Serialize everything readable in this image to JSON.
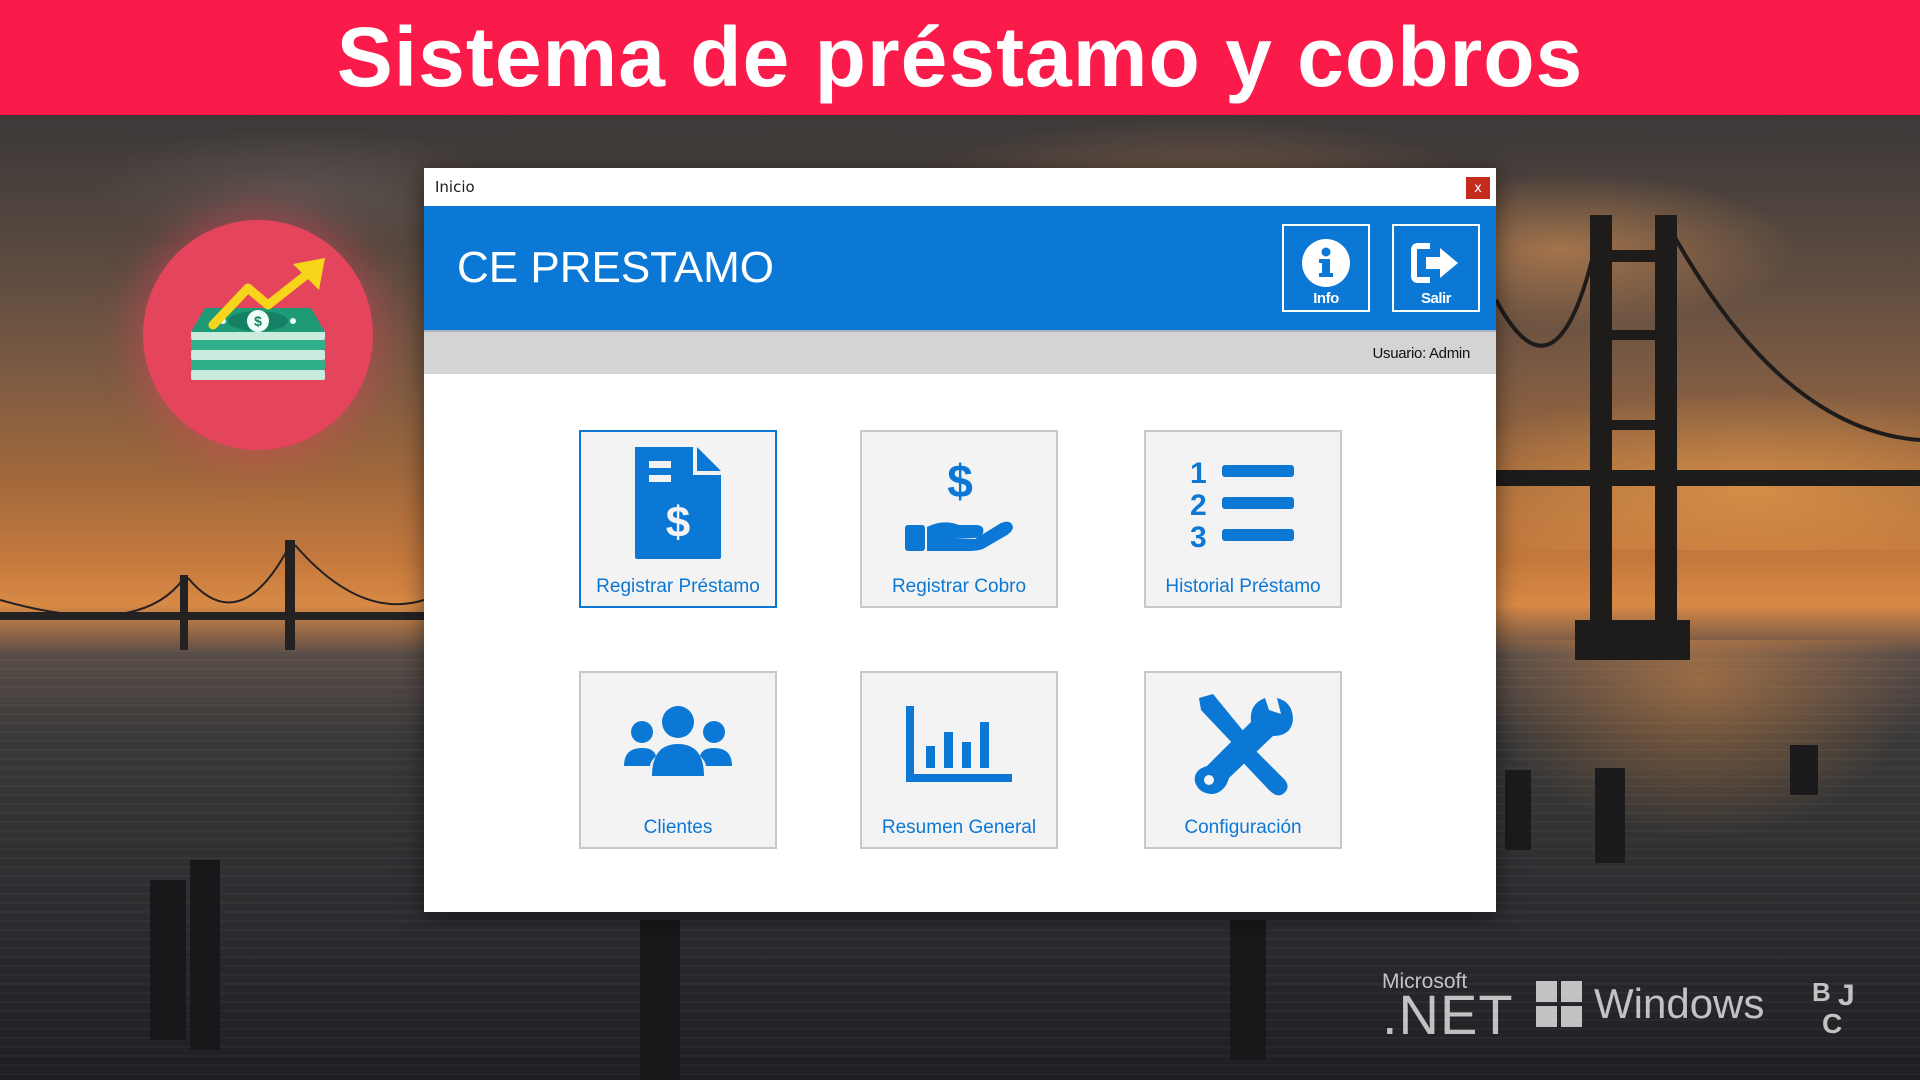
{
  "banner": {
    "title": "Sistema de préstamo y cobros"
  },
  "window": {
    "title": "Inicio",
    "close_label": "x",
    "app_title": "CE PRESTAMO",
    "header_buttons": {
      "info": "Info",
      "salir": "Salir"
    },
    "status": {
      "user_label": "Usuario: Admin"
    },
    "tiles": [
      {
        "label": "Registrar Préstamo",
        "icon": "loan-document-icon",
        "selected": true
      },
      {
        "label": "Registrar Cobro",
        "icon": "hand-dollar-icon",
        "selected": false
      },
      {
        "label": "Historial Préstamo",
        "icon": "numbered-list-icon",
        "selected": false
      },
      {
        "label": "Clientes",
        "icon": "users-icon",
        "selected": false
      },
      {
        "label": "Resumen General",
        "icon": "bar-chart-icon",
        "selected": false
      },
      {
        "label": "Configuración",
        "icon": "tools-icon",
        "selected": false
      }
    ]
  },
  "footer": {
    "microsoft": "Microsoft",
    "net": ".NET",
    "windows": "Windows",
    "bjc": "BJC"
  },
  "colors": {
    "banner": "#fb1b4b",
    "header": "#0c78d6",
    "tile_label": "#0c78d6",
    "logo_circle": "#e5455c"
  }
}
